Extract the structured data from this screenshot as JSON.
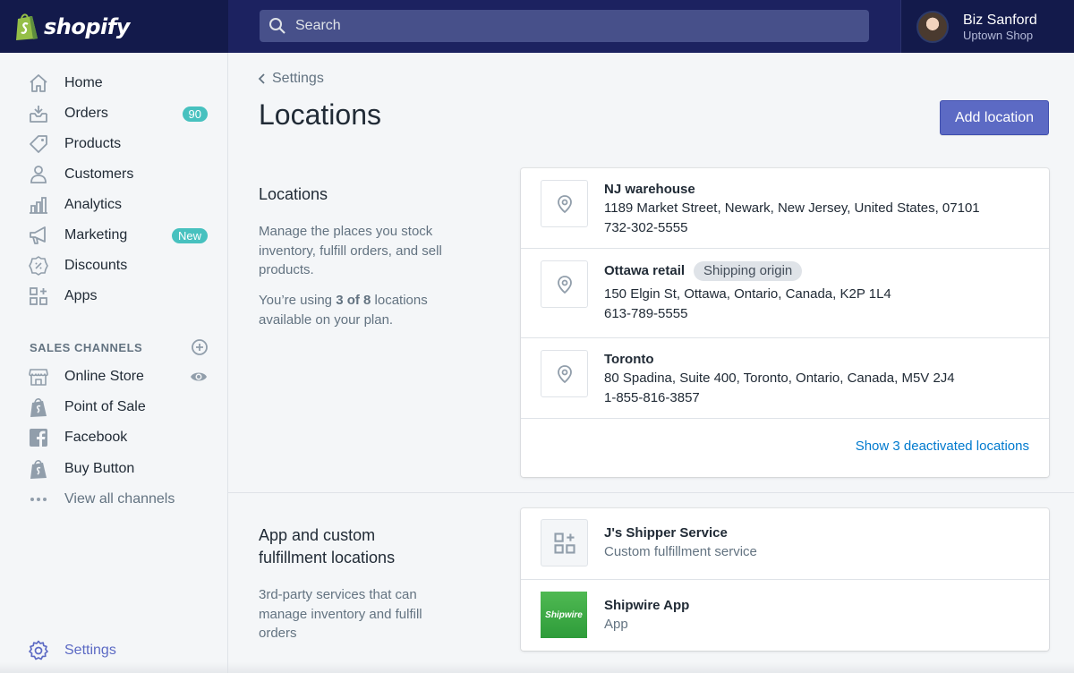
{
  "topbar": {
    "brand": "shopify",
    "search_placeholder": "Search",
    "user_name": "Biz Sanford",
    "user_shop": "Uptown Shop"
  },
  "sidebar": {
    "items": [
      {
        "label": "Home",
        "icon": "home-icon"
      },
      {
        "label": "Orders",
        "icon": "orders-icon",
        "badge": "90"
      },
      {
        "label": "Products",
        "icon": "tag-icon"
      },
      {
        "label": "Customers",
        "icon": "person-icon"
      },
      {
        "label": "Analytics",
        "icon": "bar-chart-icon"
      },
      {
        "label": "Marketing",
        "icon": "megaphone-icon",
        "badge": "New"
      },
      {
        "label": "Discounts",
        "icon": "discount-icon"
      },
      {
        "label": "Apps",
        "icon": "apps-icon"
      }
    ],
    "sales_channels_header": "SALES CHANNELS",
    "channels": [
      {
        "label": "Online Store",
        "icon": "store-icon"
      },
      {
        "label": "Point of Sale",
        "icon": "shopping-bag-icon"
      },
      {
        "label": "Facebook",
        "icon": "facebook-icon"
      },
      {
        "label": "Buy Button",
        "icon": "shopping-bag-icon"
      }
    ],
    "view_all": "View all channels",
    "settings": "Settings"
  },
  "main": {
    "breadcrumb": "Settings",
    "title": "Locations",
    "add_button": "Add location",
    "locations_section": {
      "title": "Locations",
      "description": "Manage the places you stock inventory, fulfill orders, and sell products.",
      "usage_prefix": "You’re using ",
      "usage_bold": "3 of 8",
      "usage_suffix": " locations available on your plan."
    },
    "locations": [
      {
        "name": "NJ warehouse",
        "address": "1189 Market Street, Newark, New Jersey, United States, 07101",
        "phone": "732-302-5555"
      },
      {
        "name": "Ottawa retail",
        "tag": "Shipping origin",
        "address": "150 Elgin St, Ottawa, Ontario, Canada, K2P 1L4",
        "phone": "613-789-5555"
      },
      {
        "name": "Toronto",
        "address": "80 Spadina, Suite 400, Toronto, Ontario, Canada, M5V 2J4",
        "phone": "1-855-816-3857"
      }
    ],
    "show_deactivated": "Show 3 deactivated locations",
    "fulfillment_section": {
      "title": "App and custom fulfillment locations",
      "description": "3rd-party services that can manage inventory and fulfill orders"
    },
    "fulfillment": [
      {
        "name": "J's Shipper Service",
        "type": "Custom fulfillment service"
      },
      {
        "name": "Shipwire App",
        "type": "App",
        "logo_text": "Shipwire"
      }
    ]
  },
  "colors": {
    "topbar": "#1c2260",
    "primary_button": "#5c6ac4",
    "link": "#007ace",
    "badge": "#47c1bf"
  }
}
